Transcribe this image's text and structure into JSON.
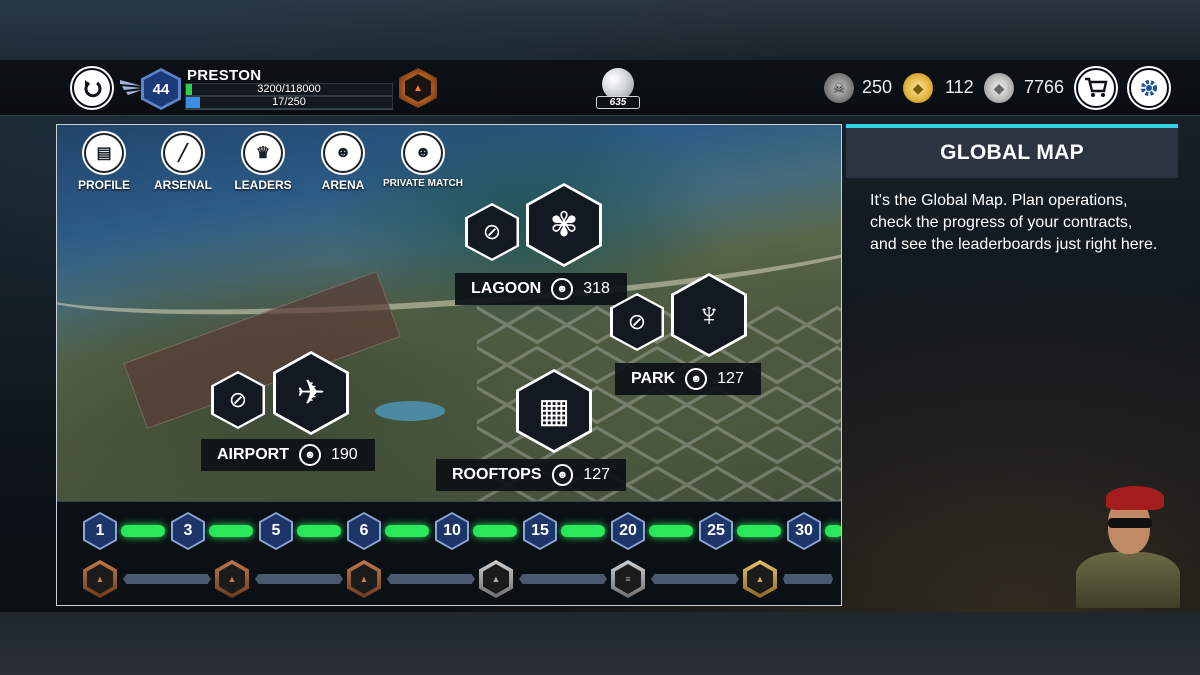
{
  "player": {
    "name": "PRESTON",
    "level": "44",
    "xp": "3200/118000",
    "xp_fraction": 0.027,
    "rank_progress": "17/250",
    "rank_fraction": 0.068
  },
  "globe": {
    "count": "635"
  },
  "currencies": {
    "skulls": "250",
    "gold": "112",
    "silver": "7766"
  },
  "menu": [
    {
      "label": "PROFILE",
      "icon": "id-card-icon"
    },
    {
      "label": "ARSENAL",
      "icon": "rifle-icon"
    },
    {
      "label": "LEADERS",
      "icon": "trophy-icon"
    },
    {
      "label": "ARENA",
      "icon": "players-icon"
    },
    {
      "label": "PRIVATE MATCH",
      "icon": "players-icon"
    }
  ],
  "locations": [
    {
      "name": "LAGOON",
      "players": "318",
      "icon": "palm-tree-icon"
    },
    {
      "name": "PARK",
      "players": "127",
      "icon": "cocktail-icon"
    },
    {
      "name": "AIRPORT",
      "players": "190",
      "icon": "airplane-icon"
    },
    {
      "name": "ROOFTOPS",
      "players": "127",
      "icon": "building-icon"
    }
  ],
  "level_milestones": [
    "1",
    "3",
    "5",
    "6",
    "10",
    "15",
    "20",
    "25",
    "30"
  ],
  "rank_milestones": [
    "bronze",
    "bronze",
    "bronze",
    "silver",
    "silver",
    "gold"
  ],
  "info": {
    "title": "GLOBAL MAP",
    "text": "It's the Global Map. Plan operations, check the progress of your contracts, and see the leaderboards just right here."
  },
  "colors": {
    "accent": "#36d0e8",
    "xp_bar": "#2bd14a",
    "rank_bar": "#3a8ee6",
    "progress_green": "#2be85b"
  }
}
